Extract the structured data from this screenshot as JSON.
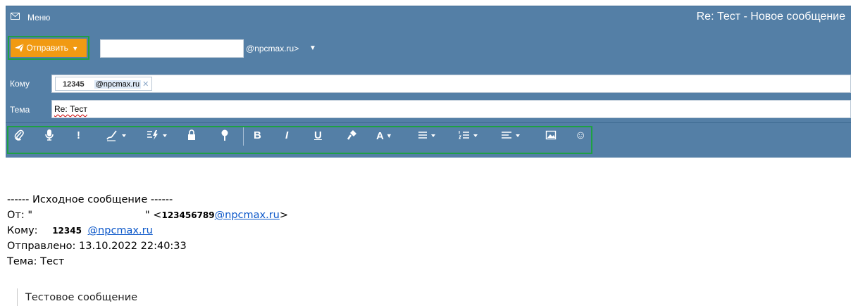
{
  "titlebar": {
    "menu_label": "Меню",
    "window_title": "Re: Тест - Новое сообщение",
    "menu_icon": "envelope-icon"
  },
  "toolbar": {
    "send_label": "Отправить",
    "send_icon": "paper-plane-icon",
    "from_value": "",
    "from_domain": "@npcmax.ru>"
  },
  "header": {
    "to_label": "Кому",
    "to_chip_name": "12345",
    "to_chip_domain": "@npcmax.ru",
    "subject_label": "Тема",
    "subject_value": "Re: Тест"
  },
  "format_toolbar": [
    {
      "name": "attach-icon"
    },
    {
      "name": "microphone-icon"
    },
    {
      "name": "importance-icon",
      "glyph": "!"
    },
    {
      "name": "signature-icon"
    },
    {
      "name": "template-icon"
    },
    {
      "name": "lock-icon"
    },
    {
      "name": "pin-icon"
    },
    {
      "name": "bold-icon",
      "glyph": "B"
    },
    {
      "name": "italic-icon",
      "glyph": "I"
    },
    {
      "name": "underline-icon",
      "glyph": "U"
    },
    {
      "name": "format-painter-icon"
    },
    {
      "name": "font-color-icon",
      "glyph": "A"
    },
    {
      "name": "bulleted-list-icon"
    },
    {
      "name": "numbered-list-icon"
    },
    {
      "name": "align-icon"
    },
    {
      "name": "insert-image-icon"
    },
    {
      "name": "emoji-icon",
      "glyph": "☺"
    }
  ],
  "body": {
    "separator": "------ Исходное сообщение ------",
    "from_prefix": "От: \"",
    "from_middle": "\" <",
    "from_bold": "123456789",
    "from_link": "@npcmax.ru",
    "from_suffix": ">",
    "to_prefix": "Кому:",
    "to_bold": "12345",
    "to_link": "@npcmax.ru",
    "sent": "Отправлено: 13.10.2022 22:40:33",
    "subject": "Тема: Тест",
    "quoted": "Тестовое сообщение"
  },
  "colors": {
    "header_bg": "#547fa6",
    "send_button": "#f19a12",
    "highlight_border": "#1ea043",
    "link": "#0b57c9"
  }
}
